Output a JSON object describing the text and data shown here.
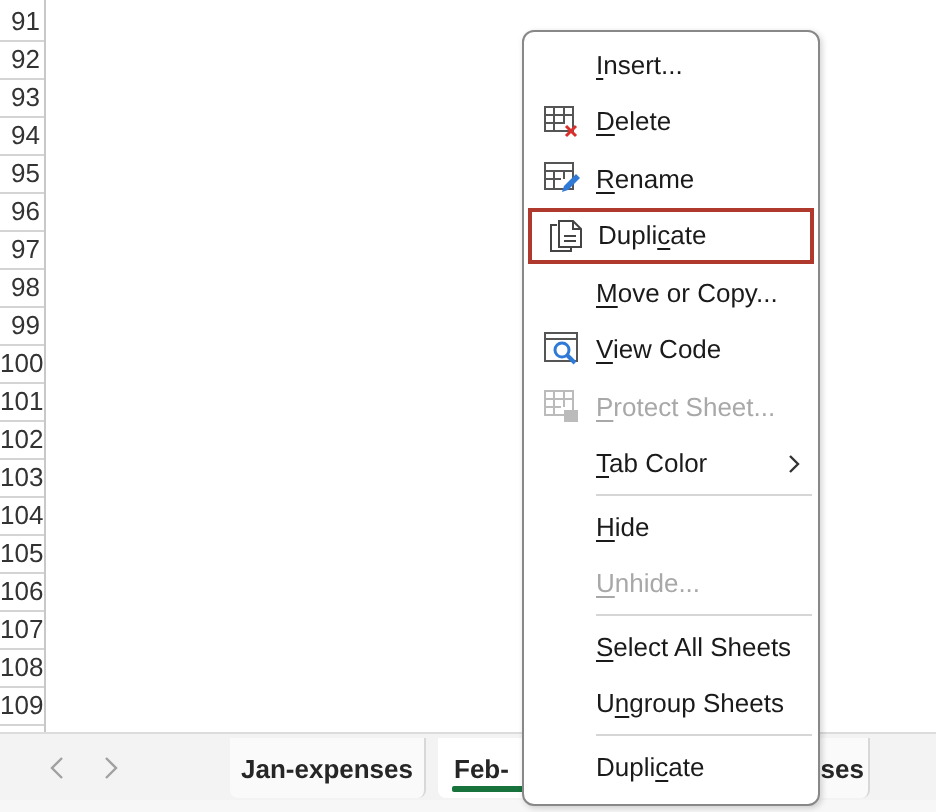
{
  "row_headers": [
    "91",
    "92",
    "93",
    "94",
    "95",
    "96",
    "97",
    "98",
    "99",
    "100",
    "101",
    "102",
    "103",
    "104",
    "105",
    "106",
    "107",
    "108",
    "109"
  ],
  "sheet_tabs": [
    {
      "label": "Jan-expenses",
      "selected": false
    },
    {
      "label": "Feb-",
      "selected": true
    },
    {
      "label": "ses",
      "selected": false
    }
  ],
  "context_menu": {
    "items": [
      {
        "kind": "item",
        "text": {
          "key": "I",
          "after": "nsert..."
        },
        "disabled": false,
        "selected": false
      },
      {
        "kind": "item",
        "text": {
          "key": "D",
          "after": "elete"
        },
        "disabled": false,
        "selected": false
      },
      {
        "kind": "item",
        "text": {
          "key": "R",
          "after": "ename"
        },
        "disabled": false,
        "selected": false
      },
      {
        "kind": "item",
        "text": {
          "before": "Dupli",
          "key": "c",
          "after": "ate"
        },
        "disabled": false,
        "selected": true
      },
      {
        "kind": "item",
        "text": {
          "key": "M",
          "after": "ove or Copy..."
        },
        "disabled": false,
        "selected": false
      },
      {
        "kind": "item",
        "text": {
          "key": "V",
          "after": "iew Code"
        },
        "disabled": false,
        "selected": false
      },
      {
        "kind": "item",
        "text": {
          "key": "P",
          "after": "rotect Sheet..."
        },
        "disabled": true,
        "selected": false
      },
      {
        "kind": "item",
        "text": {
          "key": "T",
          "after": "ab Color"
        },
        "disabled": false,
        "selected": false,
        "submenu": true
      },
      {
        "kind": "separator"
      },
      {
        "kind": "item",
        "text": {
          "key": "H",
          "after": "ide"
        },
        "disabled": false,
        "selected": false
      },
      {
        "kind": "item",
        "text": {
          "key": "U",
          "after": "nhide..."
        },
        "disabled": true,
        "selected": false
      },
      {
        "kind": "separator"
      },
      {
        "kind": "item",
        "text": {
          "key": "S",
          "after": "elect All Sheets"
        },
        "disabled": false,
        "selected": false
      },
      {
        "kind": "item",
        "text": {
          "before": "U",
          "key": "n",
          "after": "group Sheets"
        },
        "disabled": false,
        "selected": false
      },
      {
        "kind": "separator"
      },
      {
        "kind": "item",
        "text": {
          "before": "Dupli",
          "key": "c",
          "after": "ate"
        },
        "disabled": false,
        "selected": false
      }
    ]
  }
}
